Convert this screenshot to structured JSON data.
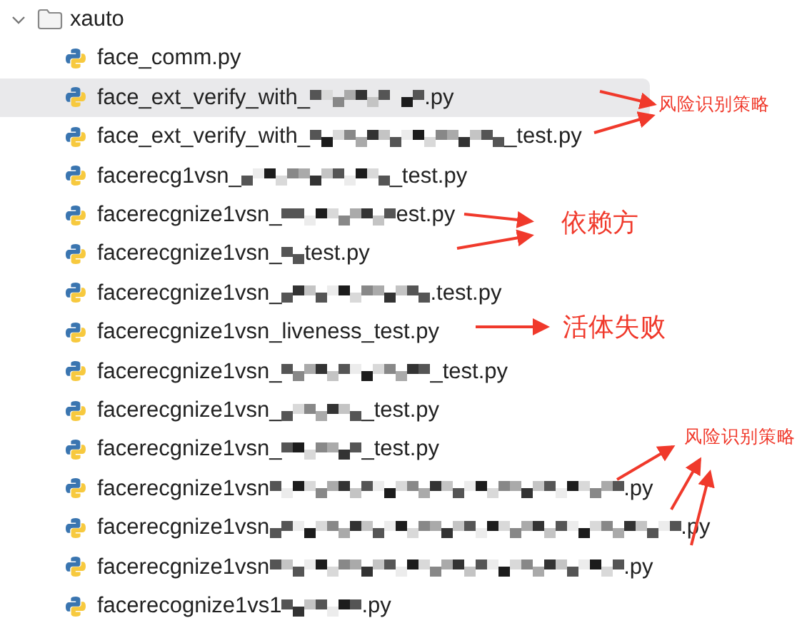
{
  "folder": {
    "name": "xauto",
    "expanded": true
  },
  "files": [
    {
      "kind": "plain",
      "name_start": "face_comm.py",
      "selected": false
    },
    {
      "kind": "medium",
      "name_start": "face_ext_verify_with_",
      "name_end": ".py",
      "selected": true
    },
    {
      "kind": "wide",
      "name_start": "face_ext_verify_with_",
      "name_end": "_test.py",
      "selected": false
    },
    {
      "kind": "large",
      "name_start": "facerecg1vsn_",
      "name_end": "_test.py",
      "selected": false
    },
    {
      "kind": "medium",
      "name_start": "facerecgnize1vsn_",
      "name_end": "est.py",
      "selected": false
    },
    {
      "kind": "tiny",
      "name_start": "facerecgnize1vsn_",
      "name_end": "test.py",
      "selected": false
    },
    {
      "kind": "large",
      "name_start": "facerecgnize1vsn_",
      "name_end": ".test.py",
      "selected": false
    },
    {
      "kind": "plain",
      "name_start": "facerecgnize1vsn_liveness_test.py",
      "selected": false
    },
    {
      "kind": "large",
      "name_start": "facerecgnize1vsn_",
      "name_end": "_test.py",
      "selected": false
    },
    {
      "kind": "small",
      "name_start": "facerecgnize1vsn_",
      "name_end": "_test.py",
      "selected": false
    },
    {
      "kind": "small",
      "name_start": "facerecgnize1vsn_",
      "name_end": "_test.py",
      "selected": false
    },
    {
      "kind": "huge",
      "name_start": "facerecgnize1vsn",
      "name_end": ".py",
      "selected": false
    },
    {
      "kind": "widest",
      "name_start": "facerecgnize1vsn",
      "name_end": ".py",
      "selected": false
    },
    {
      "kind": "huge",
      "name_start": "facerecgnize1vsn",
      "name_end": ".py",
      "selected": false
    },
    {
      "kind": "small",
      "name_start": "facerecognize1vs1",
      "name_end": ".py",
      "selected": false
    }
  ],
  "annotations": [
    {
      "kind": "small",
      "text": "风险识别策略"
    },
    {
      "kind": "large",
      "text": "依赖方"
    },
    {
      "kind": "large",
      "text": "活体失败"
    },
    {
      "kind": "small",
      "text": "风险识别策略"
    }
  ]
}
